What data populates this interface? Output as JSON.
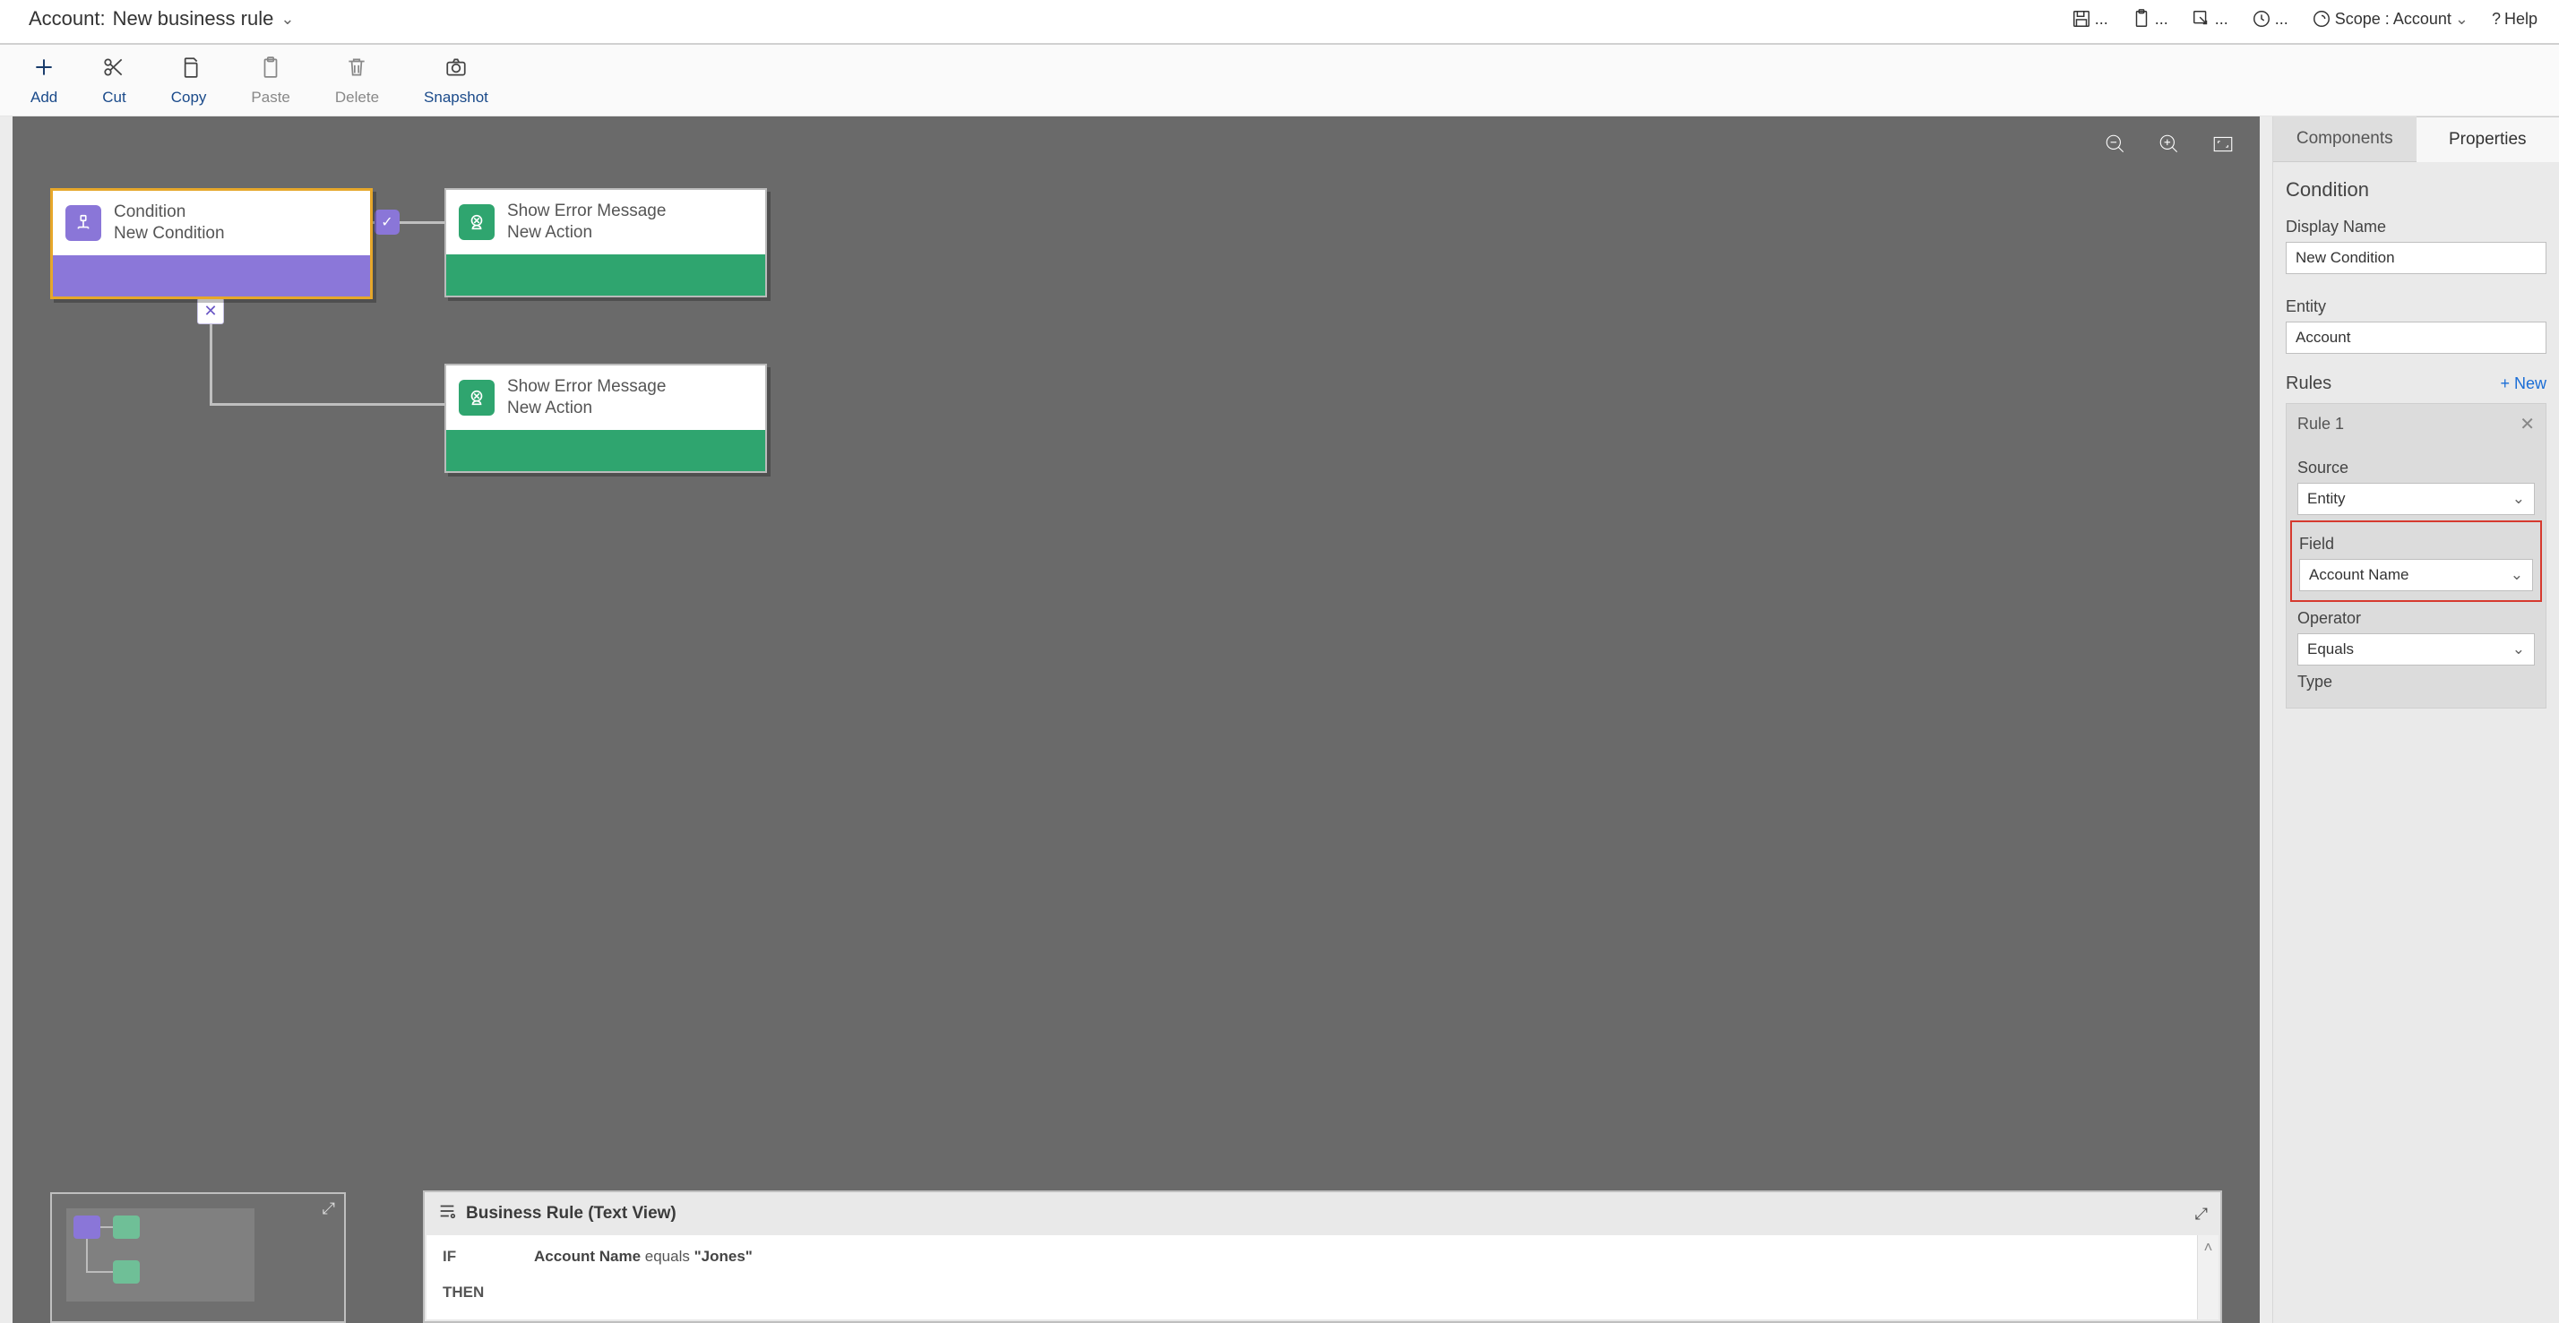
{
  "title": {
    "entity": "Account:",
    "name": "New business rule"
  },
  "topbar": {
    "scope_label": "Scope :",
    "scope_value": "Account",
    "help": "Help"
  },
  "toolbar": {
    "add": "Add",
    "cut": "Cut",
    "copy": "Copy",
    "paste": "Paste",
    "delete": "Delete",
    "snapshot": "Snapshot"
  },
  "canvas": {
    "nodes": {
      "condition": {
        "title": "Condition",
        "subtitle": "New Condition"
      },
      "action1": {
        "title": "Show Error Message",
        "subtitle": "New Action"
      },
      "action2": {
        "title": "Show Error Message",
        "subtitle": "New Action"
      }
    }
  },
  "textview": {
    "heading": "Business Rule (Text View)",
    "if_label": "IF",
    "then_label": "THEN",
    "line1_field": "Account Name",
    "line1_middle": " equals ",
    "line1_value": "\"Jones\""
  },
  "side": {
    "tabs": {
      "components": "Components",
      "properties": "Properties"
    },
    "section_title": "Condition",
    "display_name_label": "Display Name",
    "display_name_value": "New Condition",
    "entity_label": "Entity",
    "entity_value": "Account",
    "rules_label": "Rules",
    "new_label": "+  New",
    "rule1_label": "Rule 1",
    "source_label": "Source",
    "source_value": "Entity",
    "field_label": "Field",
    "field_value": "Account Name",
    "operator_label": "Operator",
    "operator_value": "Equals",
    "type_label": "Type"
  }
}
